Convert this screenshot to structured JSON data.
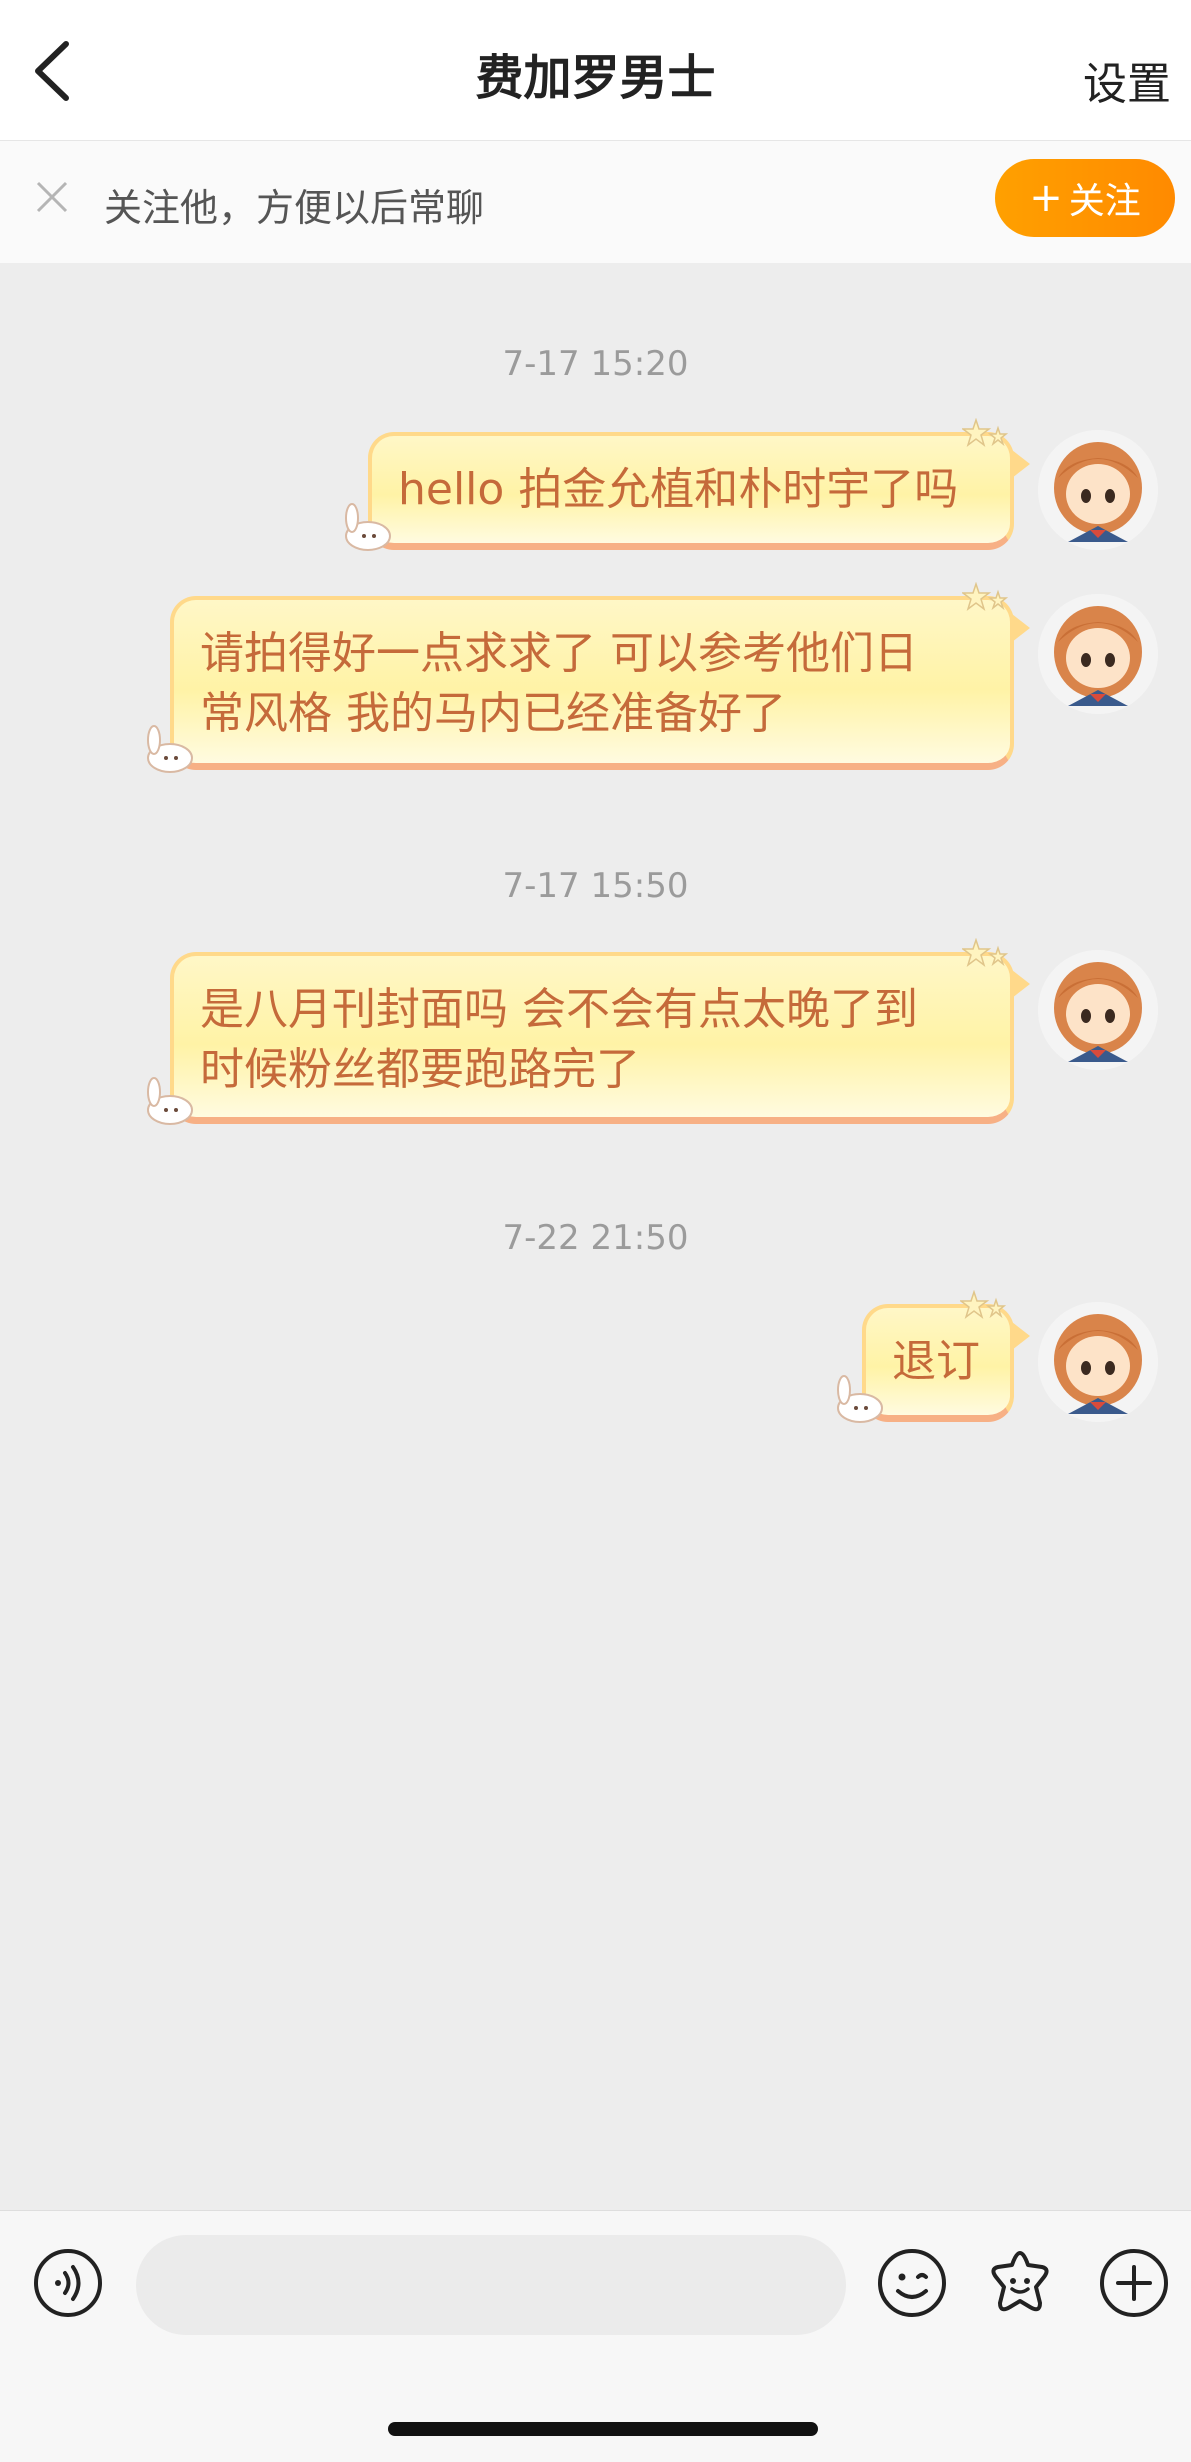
{
  "header": {
    "title": "费加罗男士",
    "settings_label": "设置"
  },
  "follow_bar": {
    "prompt": "关注他，方便以后常聊",
    "button_label": "关注",
    "button_color": "#ff9500"
  },
  "messages": [
    {
      "time": "7-17 15:20"
    },
    {
      "text": "hello 拍金允植和朴时宇了吗"
    },
    {
      "text_line1": "请拍得好一点求求了 可以参考他们日",
      "text_line2": "常风格 我的马内已经准备好了"
    },
    {
      "time": "7-17 15:50"
    },
    {
      "text_line1": "是八月刊封面吗 会不会有点太晚了到",
      "text_line2": "时候粉丝都要跑路完了"
    },
    {
      "time": "7-22 21:50"
    },
    {
      "text": "退订"
    }
  ],
  "composer": {
    "input_placeholder": "",
    "icons": [
      "voice-icon",
      "emoji-icon",
      "sticker-icon",
      "plus-icon"
    ]
  },
  "colors": {
    "bubble_text": "#c56a3a",
    "bubble_fill": "#fff3a6",
    "background": "#ededed"
  }
}
